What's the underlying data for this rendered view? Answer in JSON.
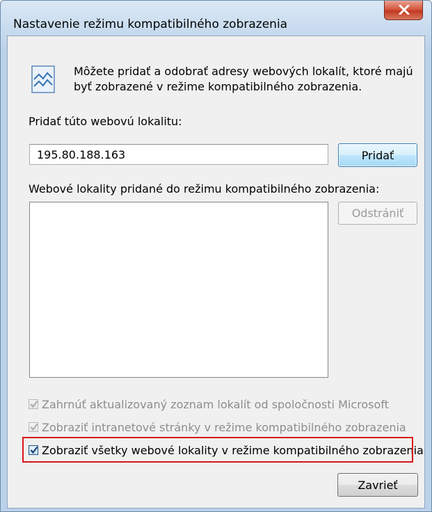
{
  "window": {
    "title": "Nastavenie režimu kompatibilného zobrazenia",
    "close_icon": "close-icon"
  },
  "info": {
    "icon": "compat-view-icon",
    "text": "Môžete pridať a odobrať adresy webových lokalít, ktoré majú byť zobrazené v režime kompatibilného zobrazenia."
  },
  "add_site": {
    "label": "Pridať túto webovú lokalitu:",
    "value": "195.80.188.163",
    "button_label": "Pridať"
  },
  "site_list": {
    "label": "Webové lokality pridané do režimu kompatibilného zobrazenia:",
    "items": [],
    "remove_button_label": "Odstrániť"
  },
  "options": [
    {
      "label": "Zahrnúť aktualizovaný zoznam lokalít od spoločnosti Microsoft",
      "checked": true,
      "enabled": false
    },
    {
      "label": "Zobraziť intranetové stránky v režime kompatibilného zobrazenia",
      "checked": true,
      "enabled": false
    },
    {
      "label": "Zobraziť všetky webové lokality v režime kompatibilného zobrazenia",
      "checked": true,
      "enabled": true,
      "highlighted": true
    }
  ],
  "footer": {
    "close_button_label": "Zavrieť"
  },
  "colors": {
    "highlight": "#d9141c",
    "close_button": "#c23a22"
  }
}
